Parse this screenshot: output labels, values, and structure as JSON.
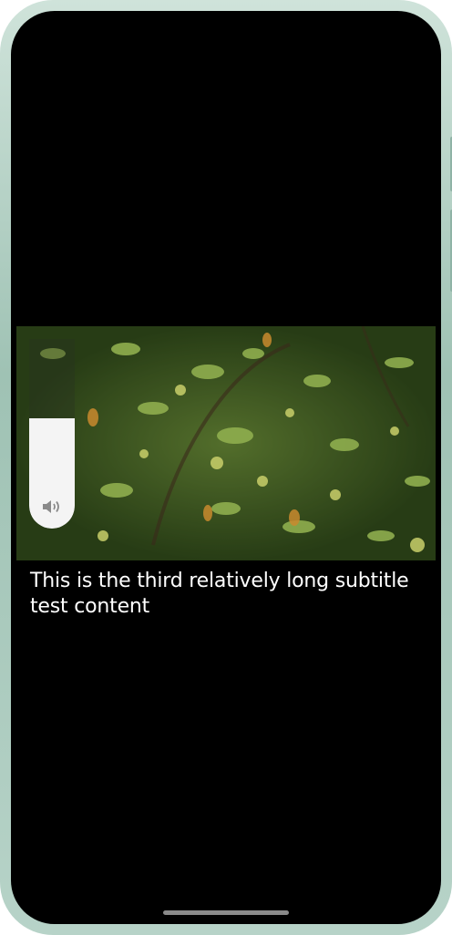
{
  "video": {
    "subtitle": "This is the third relatively long subtitle test content"
  },
  "volume": {
    "level": 0.58,
    "icon": "speaker-icon"
  },
  "colors": {
    "screen_background": "#000000",
    "subtitle_text": "#ffffff",
    "slider_fill": "#f4f4f4",
    "device_frame": "#b7d3c8"
  }
}
